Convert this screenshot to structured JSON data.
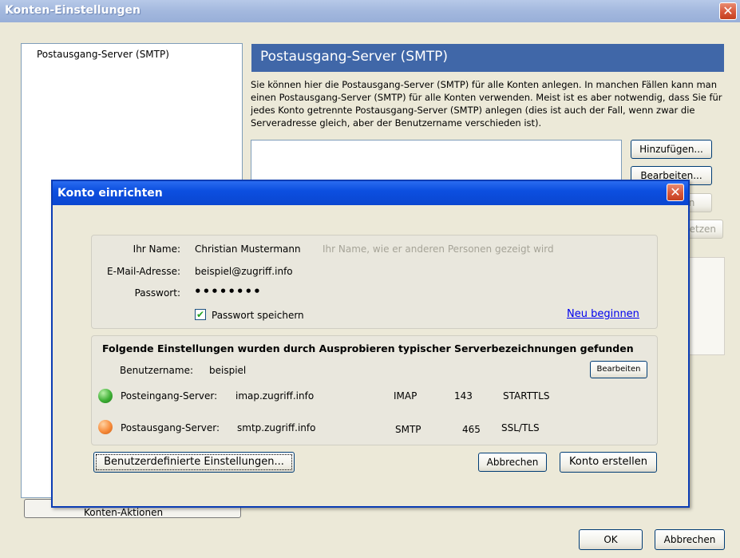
{
  "outer": {
    "title": "Konten-Einstellungen",
    "account_list": [
      "Postausgang-Server (SMTP)"
    ],
    "panel_title": "Postausgang-Server (SMTP)",
    "panel_description": "Sie können hier die Postausgang-Server (SMTP) für alle Konten anlegen. In manchen Fällen kann man einen Postausgang-Server (SMTP) für alle Konten verwenden. Meist ist es aber notwendig, dass Sie für jedes Konto getrennte Postausgang-Server (SMTP) anlegen (dies ist auch der Fall, wenn zwar die Serveradresse gleich, aber der Benutzername verschieden ist).",
    "buttons": {
      "add": "Hinzufügen...",
      "edit": "Bearbeiten...",
      "remove": "Entfernen",
      "set_default": "Standard setzen"
    },
    "konto_aktionen": "Konten-Aktionen",
    "ok": "OK",
    "cancel": "Abbrechen"
  },
  "dialog": {
    "title": "Konto einrichten",
    "name_label": "Ihr Name:",
    "name_value": "Christian Mustermann",
    "name_hint": "Ihr Name, wie er anderen Personen gezeigt wird",
    "email_label": "E-Mail-Adresse:",
    "email_value": "beispiel@zugriff.info",
    "password_label": "Passwort:",
    "password_value": "••••••••",
    "save_password_label": "Passwort speichern",
    "save_password_checked": true,
    "restart_link": "Neu beginnen",
    "found_title": "Folgende Einstellungen wurden durch Ausprobieren typischer Serverbezeichnungen gefunden",
    "username_label": "Benutzername:",
    "username_value": "beispiel",
    "edit_button": "Bearbeiten",
    "incoming": {
      "label": "Posteingang-Server:",
      "host": "imap.zugriff.info",
      "protocol": "IMAP",
      "port": "143",
      "security": "STARTTLS",
      "status_color": "#3fb036"
    },
    "outgoing": {
      "label": "Postausgang-Server:",
      "host": "smtp.zugriff.info",
      "protocol": "SMTP",
      "port": "465",
      "security": "SSL/TLS",
      "status_color": "#f78b3a"
    },
    "custom_settings_button": "Benutzerdefinierte Einstellungen...",
    "cancel_button": "Abbrechen",
    "create_button": "Konto erstellen"
  }
}
